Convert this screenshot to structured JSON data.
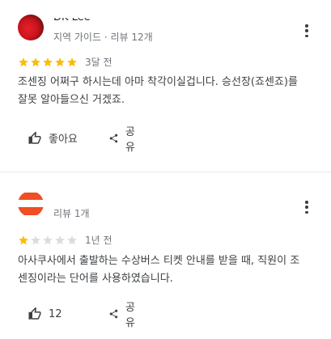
{
  "reviews": [
    {
      "reviewer_name": "DK Lee",
      "reviewer_meta": "지역 가이드 · 리뷰 12개",
      "rating": 5,
      "max_rating": 5,
      "age": "3달 전",
      "text": "조센징 어쩌구 하시는데 아마 착각이실겁니다. 승선장(죠센죠)를 잘못 알아들으신 거겠죠.",
      "like_label": "좋아요",
      "share_label": "공유"
    },
    {
      "reviewer_name": "",
      "reviewer_meta": "리뷰 1개",
      "rating": 1,
      "max_rating": 5,
      "age": "1년 전",
      "text": "아사쿠사에서 출발하는 수상버스 티켓 안내를 받을 때, 직원이 조센징이라는 단어를 사용하였습니다.",
      "like_label": "12",
      "share_label": "공유"
    }
  ],
  "colors": {
    "star_filled": "#fbbc04",
    "star_empty": "#dadce0",
    "secondary_text": "#70757a",
    "body_text": "#3c4043",
    "divider": "#e8eaed"
  },
  "icons": {
    "more": "more-vert-icon",
    "like": "thumb-up-icon",
    "share": "share-icon",
    "star": "star-icon"
  }
}
